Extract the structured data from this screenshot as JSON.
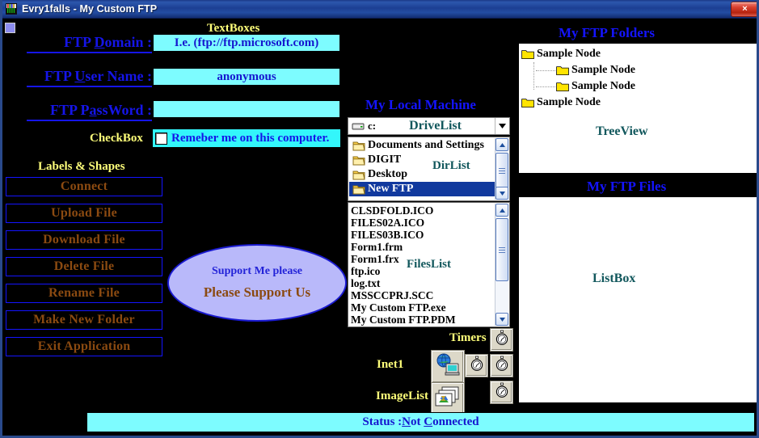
{
  "window": {
    "title": "Evry1falls - My Custom FTP",
    "app_icon": "app-icon",
    "close_label": "×"
  },
  "form": {
    "textboxes_caption": "TextBoxes",
    "fields": [
      {
        "label": "FTP Domain :",
        "accel": "D",
        "value": "I.e. (ftp://ftp.microsoft.com)",
        "placeholder": "I.e. (ftp://ftp.microsoft.com)"
      },
      {
        "label": "FTP User Name :",
        "accel": "U",
        "value": "anonymous",
        "placeholder": "anonymous"
      },
      {
        "label": "FTP PassWord :",
        "accel": "a",
        "value": "",
        "placeholder": ""
      }
    ],
    "checkbox_caption": "CheckBox",
    "checkbox_label": "Remeber me on this computer.",
    "checkbox_checked": false
  },
  "buttons": {
    "caption": "Labels & Shapes",
    "items": [
      {
        "label": "Connect"
      },
      {
        "label": "Upload File"
      },
      {
        "label": "Download File"
      },
      {
        "label": "Delete File"
      },
      {
        "label": "Rename File"
      },
      {
        "label": "Make New Folder"
      },
      {
        "label": "Exit Application"
      }
    ]
  },
  "shape": {
    "line1": "Support Me please",
    "line2": "Please Support Us"
  },
  "local_machine": {
    "caption": "My Local Machine",
    "drivelist": {
      "annotation": "DriveList",
      "selected": "c:",
      "icon": "drive-icon",
      "arrow": "▼"
    },
    "dirlist": {
      "annotation": "DirList",
      "items": [
        {
          "label": "Documents and Settings",
          "selected": false
        },
        {
          "label": "DIGIT",
          "selected": false
        },
        {
          "label": "Desktop",
          "selected": false
        },
        {
          "label": "New FTP",
          "selected": true
        }
      ]
    },
    "fileslist": {
      "annotation": "FilesList",
      "items": [
        "CLSDFOLD.ICO",
        "FILES02A.ICO",
        "FILES03B.ICO",
        "Form1.frm",
        "Form1.frx",
        "ftp.ico",
        "log.txt",
        "MSSCCPRJ.SCC",
        "My Custom FTP.exe",
        "My Custom FTP.PDM"
      ]
    }
  },
  "ftp_folders": {
    "caption": "My FTP Folders",
    "annotation": "TreeView",
    "nodes": [
      {
        "label": "Sample Node",
        "depth": 0
      },
      {
        "label": "Sample Node",
        "depth": 1
      },
      {
        "label": "Sample Node",
        "depth": 1
      },
      {
        "label": "Sample Node",
        "depth": 0
      }
    ]
  },
  "ftp_files": {
    "caption": "My FTP Files",
    "annotation": "ListBox"
  },
  "components": {
    "timers_caption": "Timers",
    "inet_caption": "Inet1",
    "imagelist_caption": "ImageList",
    "timer_count": 4
  },
  "status": {
    "prefix": "Status : ",
    "text": "Not Connected"
  },
  "colors": {
    "form_background": "#000000",
    "accent_blue": "#1414ff",
    "caption_yellow": "#ffff7a",
    "textbox_cyan": "#7dfcff",
    "button_text": "#8b4a11",
    "annotation_teal": "#11575c",
    "titlebar_blue": "#1c3f93",
    "shape_fill": "#b9b9fa"
  }
}
